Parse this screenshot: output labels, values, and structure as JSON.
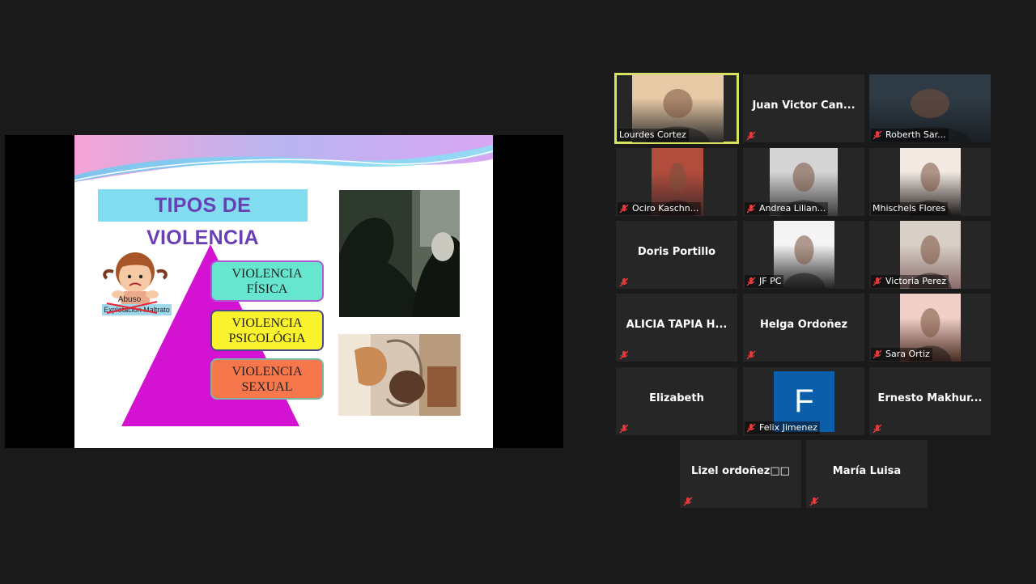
{
  "slide": {
    "title": "TIPOS DE VIOLENCIA",
    "boxes": [
      "VIOLENCIA\nFÍSICA",
      "VIOLENCIA\nPSICOLÓGIA",
      "VIOLENCIA\nSEXUAL"
    ],
    "child_words": [
      "Abuso",
      "Explotación  Maltrato"
    ]
  },
  "participants": [
    {
      "name": "Lourdes Cortez",
      "type": "video",
      "muted": false,
      "active": true
    },
    {
      "name": "Juan Victor Can...",
      "type": "name",
      "muted": true
    },
    {
      "name": "Roberth Sar...",
      "type": "video",
      "muted": true
    },
    {
      "name": "Ociro Kaschn...",
      "type": "video",
      "muted": true
    },
    {
      "name": "Andrea Lilian...",
      "type": "video",
      "muted": true
    },
    {
      "name": "Mhischels Flores",
      "type": "video",
      "muted": false
    },
    {
      "name": "Doris Portillo",
      "type": "name",
      "muted": true
    },
    {
      "name": "JF PC",
      "type": "video",
      "muted": true
    },
    {
      "name": "Victoria Perez",
      "type": "video",
      "muted": true
    },
    {
      "name": "ALICIA TAPIA H...",
      "type": "name",
      "muted": true
    },
    {
      "name": "Helga Ordoñez",
      "type": "name",
      "muted": true
    },
    {
      "name": "Sara Ortiz",
      "type": "video",
      "muted": true
    },
    {
      "name": "Elizabeth",
      "type": "name",
      "muted": true
    },
    {
      "name": "Felix Jimenez",
      "type": "avatar",
      "avatar_letter": "F",
      "muted": true
    },
    {
      "name": "Ernesto  Makhur...",
      "type": "name",
      "muted": true
    },
    {
      "name": "Lizel  ordoñez□□",
      "type": "name",
      "muted": true
    },
    {
      "name": "María Luisa",
      "type": "name",
      "muted": true
    }
  ],
  "colors": {
    "background": "#1a1a1a",
    "tile": "#262626",
    "active_border": "#d7e35f",
    "muted_icon": "#e5393a",
    "avatar_bg": "#0b5eaa"
  }
}
